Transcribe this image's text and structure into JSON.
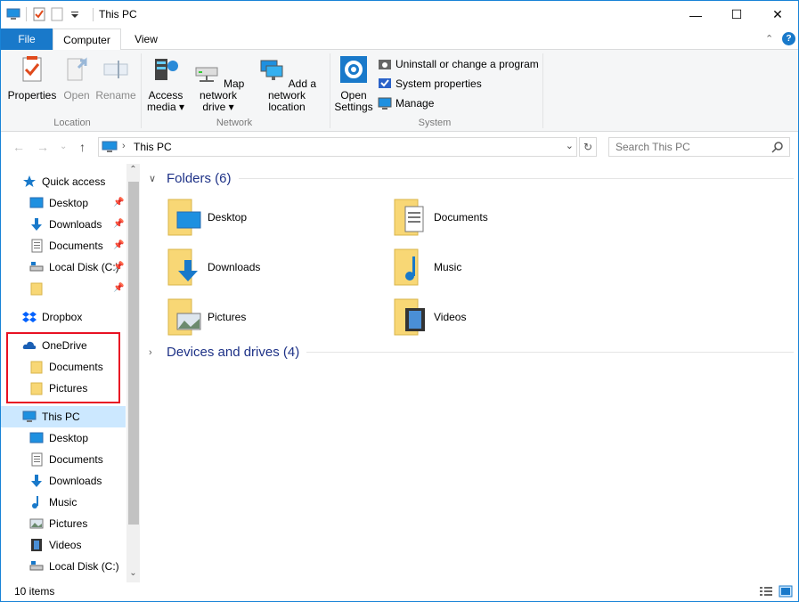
{
  "window": {
    "title": "This PC",
    "controls": {
      "minimize": "—",
      "maximize": "☐",
      "close": "✕"
    }
  },
  "ribbon_tabs": [
    {
      "label": "File"
    },
    {
      "label": "Computer"
    },
    {
      "label": "View"
    }
  ],
  "ribbon": {
    "location": {
      "label": "Location",
      "buttons": [
        {
          "label": "Properties"
        },
        {
          "label": "Open"
        },
        {
          "label": "Rename"
        }
      ]
    },
    "network": {
      "label": "Network",
      "buttons": [
        {
          "line1": "Access",
          "line2": "media ▾"
        },
        {
          "line1": "Map network",
          "line2": "drive ▾"
        },
        {
          "line1": "Add a network",
          "line2": "location"
        }
      ]
    },
    "system": {
      "label": "System",
      "open_settings": {
        "line1": "Open",
        "line2": "Settings"
      },
      "small_buttons": [
        {
          "label": "Uninstall or change a program"
        },
        {
          "label": "System properties"
        },
        {
          "label": "Manage"
        }
      ]
    }
  },
  "address": {
    "path": "This PC",
    "search_placeholder": "Search This PC"
  },
  "nav_pane": {
    "quick_access": "Quick access",
    "quick_items": [
      {
        "label": "Desktop"
      },
      {
        "label": "Downloads"
      },
      {
        "label": "Documents"
      },
      {
        "label": "Local Disk (C:)"
      },
      {
        "label": ""
      }
    ],
    "dropbox": "Dropbox",
    "onedrive": "OneDrive",
    "onedrive_items": [
      {
        "label": "Documents"
      },
      {
        "label": "Pictures"
      }
    ],
    "this_pc": "This PC",
    "this_pc_items": [
      {
        "label": "Desktop"
      },
      {
        "label": "Documents"
      },
      {
        "label": "Downloads"
      },
      {
        "label": "Music"
      },
      {
        "label": "Pictures"
      },
      {
        "label": "Videos"
      },
      {
        "label": "Local Disk (C:)"
      }
    ]
  },
  "content": {
    "folders_header": "Folders (6)",
    "folders": [
      {
        "label": "Desktop"
      },
      {
        "label": "Documents"
      },
      {
        "label": "Downloads"
      },
      {
        "label": "Music"
      },
      {
        "label": "Pictures"
      },
      {
        "label": "Videos"
      }
    ],
    "devices_header": "Devices and drives (4)"
  },
  "status": {
    "item_count": "10 items"
  },
  "colors": {
    "accent": "#1979ca",
    "folder": "#f8d775",
    "group_header": "#1e3287",
    "selected": "#cce8ff",
    "highlight": "#e81123"
  }
}
